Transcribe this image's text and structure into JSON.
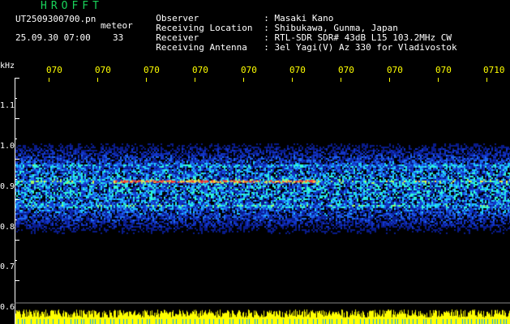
{
  "colors": {
    "title": "#19d35a",
    "text": "#ffffff",
    "axis": "#ffff00",
    "background": "#000000",
    "spectrum_low": "#0a1c8c",
    "spectrum_mid": "#1ec8ff",
    "spectrum_high": "#ff3030",
    "baseline": "#ffff00"
  },
  "header": {
    "title": "HROFFT",
    "filename": "UT2509300700.pn",
    "meteor_label": "meteor",
    "date": "25.09.30 07:00",
    "count": "33"
  },
  "info": [
    {
      "key": "Observer",
      "sep": ":",
      "value": "Masaki Kano"
    },
    {
      "key": "Receiving Location",
      "sep": ":",
      "value": "Shibukawa, Gunma, Japan"
    },
    {
      "key": "Receiver",
      "sep": ":",
      "value": "RTL-SDR SDR# 43dB L15 103.2MHz CW"
    },
    {
      "key": "Receiving Antenna",
      "sep": ":",
      "value": "3el Yagi(V) Az 330 for Vladivostok"
    }
  ],
  "axis": {
    "y_label": "kHz",
    "y_ticks": [
      "1.1",
      "1.0",
      "0.9",
      "0.8",
      "0.7",
      "0.6"
    ],
    "x_ticks": [
      "070",
      "070",
      "070",
      "070",
      "070",
      "070",
      "070",
      "070",
      "070",
      "0710"
    ]
  },
  "spectrogram": {
    "freq_range_khz": [
      0.6,
      1.15
    ],
    "signal_band_khz": [
      0.79,
      1.02
    ],
    "echo_lines_khz": [
      0.955,
      0.92,
      0.865
    ]
  }
}
